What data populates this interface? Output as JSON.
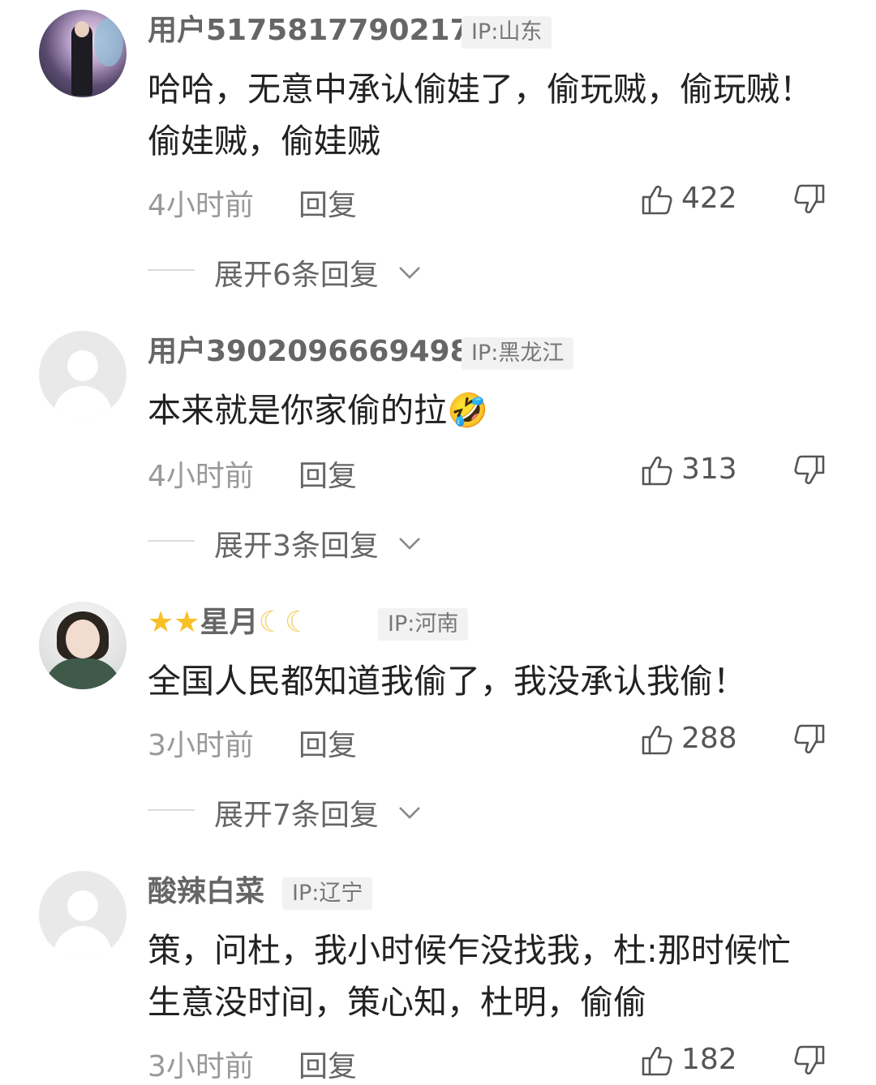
{
  "comments": [
    {
      "username": "用户5175817790217",
      "ip": "IP:山东",
      "text": "哈哈，无意中承认偷娃了，偷玩贼，偷玩贼！偷娃贼，偷娃贼",
      "time": "4小时前",
      "reply_label": "回复",
      "likes": "422",
      "expand_label": "展开6条回复",
      "avatar": "photo-avatar"
    },
    {
      "username": "用户3902096669498",
      "ip": "IP:黑龙江",
      "text": "本来就是你家偷的拉🤣",
      "time": "4小时前",
      "reply_label": "回复",
      "likes": "313",
      "expand_label": "展开3条回复",
      "avatar": "default-avatar"
    },
    {
      "username": "⭐⭐星月🌙🌙",
      "username_text": "星月",
      "ip": "IP:河南",
      "text": "全国人民都知道我偷了，我没承认我偷！",
      "time": "3小时前",
      "reply_label": "回复",
      "likes": "288",
      "expand_label": "展开7条回复",
      "avatar": "photo-avatar"
    },
    {
      "username": "酸辣白菜",
      "ip": "IP:辽宁",
      "text": "策，问杜，我小时候乍没找我，杜:那时候忙生意没时间，策心知，杜明，偷偷",
      "time": "3小时前",
      "reply_label": "回复",
      "likes": "182",
      "avatar": "default-avatar"
    }
  ],
  "icons": {
    "like": "thumbs-up-icon",
    "dislike": "thumbs-down-icon",
    "expand": "chevron-down-icon"
  },
  "colors": {
    "username": "#666666",
    "meta": "#999999",
    "ip_badge_bg": "#f2f2f2"
  }
}
